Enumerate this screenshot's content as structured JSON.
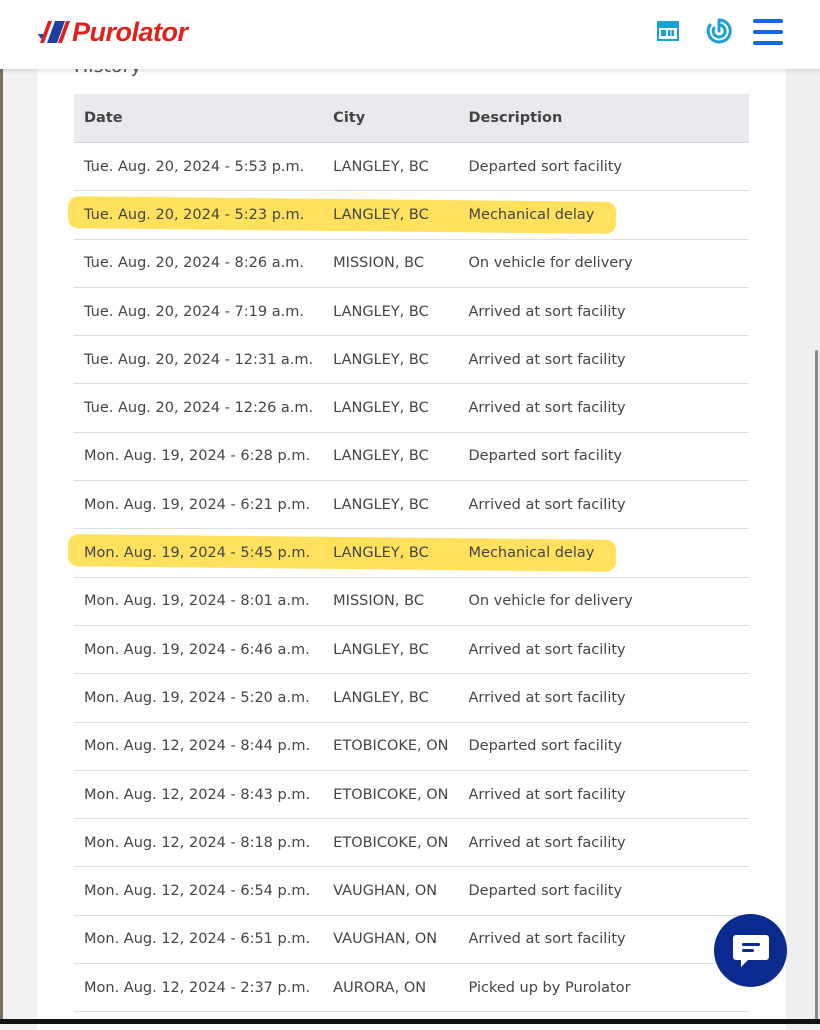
{
  "header": {
    "brand": "Purolator",
    "brand_color": "#e0201b",
    "accent_color": "#1a9fd6",
    "icons": [
      "store-locator-icon",
      "tracker-icon",
      "hamburger-menu-icon"
    ]
  },
  "history": {
    "title": "History",
    "columns": [
      "Date",
      "City",
      "Description"
    ],
    "rows": [
      {
        "date": "Tue. Aug. 20, 2024 - 5:53 p.m.",
        "city": "LANGLEY, BC",
        "description": "Departed sort facility",
        "highlighted": false
      },
      {
        "date": "Tue. Aug. 20, 2024 - 5:23 p.m.",
        "city": "LANGLEY, BC",
        "description": "Mechanical delay",
        "highlighted": true
      },
      {
        "date": "Tue. Aug. 20, 2024 - 8:26 a.m.",
        "city": "MISSION, BC",
        "description": "On vehicle for delivery",
        "highlighted": false
      },
      {
        "date": "Tue. Aug. 20, 2024 - 7:19 a.m.",
        "city": "LANGLEY, BC",
        "description": "Arrived at sort facility",
        "highlighted": false
      },
      {
        "date": "Tue. Aug. 20, 2024 - 12:31 a.m.",
        "city": "LANGLEY, BC",
        "description": "Arrived at sort facility",
        "highlighted": false
      },
      {
        "date": "Tue. Aug. 20, 2024 - 12:26 a.m.",
        "city": "LANGLEY, BC",
        "description": "Arrived at sort facility",
        "highlighted": false
      },
      {
        "date": "Mon. Aug. 19, 2024 - 6:28 p.m.",
        "city": "LANGLEY, BC",
        "description": "Departed sort facility",
        "highlighted": false
      },
      {
        "date": "Mon. Aug. 19, 2024 - 6:21 p.m.",
        "city": "LANGLEY, BC",
        "description": "Arrived at sort facility",
        "highlighted": false
      },
      {
        "date": "Mon. Aug. 19, 2024 - 5:45 p.m.",
        "city": "LANGLEY, BC",
        "description": "Mechanical delay",
        "highlighted": true
      },
      {
        "date": "Mon. Aug. 19, 2024 - 8:01 a.m.",
        "city": "MISSION, BC",
        "description": "On vehicle for delivery",
        "highlighted": false
      },
      {
        "date": "Mon. Aug. 19, 2024 - 6:46 a.m.",
        "city": "LANGLEY, BC",
        "description": "Arrived at sort facility",
        "highlighted": false
      },
      {
        "date": "Mon. Aug. 19, 2024 - 5:20 a.m.",
        "city": "LANGLEY, BC",
        "description": "Arrived at sort facility",
        "highlighted": false
      },
      {
        "date": "Mon. Aug. 12, 2024 - 8:44 p.m.",
        "city": "ETOBICOKE, ON",
        "description": "Departed sort facility",
        "highlighted": false
      },
      {
        "date": "Mon. Aug. 12, 2024 - 8:43 p.m.",
        "city": "ETOBICOKE, ON",
        "description": "Arrived at sort facility",
        "highlighted": false
      },
      {
        "date": "Mon. Aug. 12, 2024 - 8:18 p.m.",
        "city": "ETOBICOKE, ON",
        "description": "Arrived at sort facility",
        "highlighted": false
      },
      {
        "date": "Mon. Aug. 12, 2024 - 6:54 p.m.",
        "city": "VAUGHAN, ON",
        "description": "Departed sort facility",
        "highlighted": false
      },
      {
        "date": "Mon. Aug. 12, 2024 - 6:51 p.m.",
        "city": "VAUGHAN, ON",
        "description": "Arrived at sort facility",
        "highlighted": false
      },
      {
        "date": "Mon. Aug. 12, 2024 - 2:37 p.m.",
        "city": "AURORA, ON",
        "description": "Picked up by Purolator",
        "highlighted": false
      }
    ]
  },
  "chat": {
    "icon": "chat-bubble-icon",
    "color": "#0b2a8f"
  }
}
